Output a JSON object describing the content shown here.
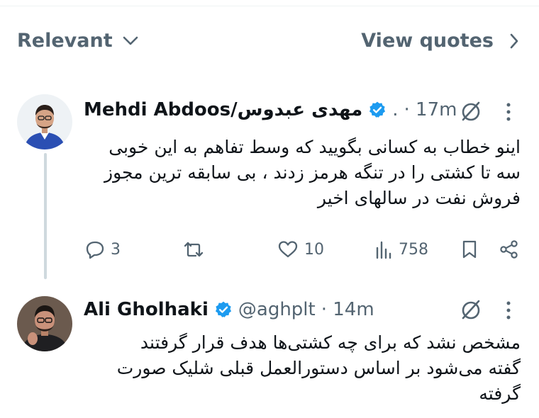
{
  "sort": {
    "label": "Relevant",
    "quotes_label": "View quotes"
  },
  "tweets": [
    {
      "name": "Mehdi Abdoos/مهدی عبدوس",
      "handle": ".",
      "time": "· 17m",
      "lines": [
        "اینو خطاب به کسانی بگویید که وسط تفاهم به این خوبی",
        "سه تا کشتی را در تنگه هرمز زدند ، بی سابقه ترین مجوز",
        "فروش نفت در سالهای اخیر"
      ],
      "replies": "3",
      "likes": "10",
      "views": "758"
    },
    {
      "name": "Ali Gholhaki",
      "handle": "@aghplt",
      "time": "· 14m",
      "lines": [
        "مشخص نشد که برای چه کشتی‌ها هدف قرار گرفتند",
        "گفته می‌شود بر اساس دستورالعمل قبلی شلیک صورت",
        "گرفته"
      ]
    }
  ],
  "icons": [
    "chevron-down-icon",
    "chevron-right-icon",
    "verified-badge-icon",
    "grok-icon",
    "more-icon",
    "reply-icon",
    "retweet-icon",
    "like-icon",
    "views-icon",
    "bookmark-icon",
    "share-icon"
  ],
  "colors": {
    "verified": "#1d9bf0",
    "secondary_text": "#536471",
    "thread_line": "#cfd9de"
  }
}
